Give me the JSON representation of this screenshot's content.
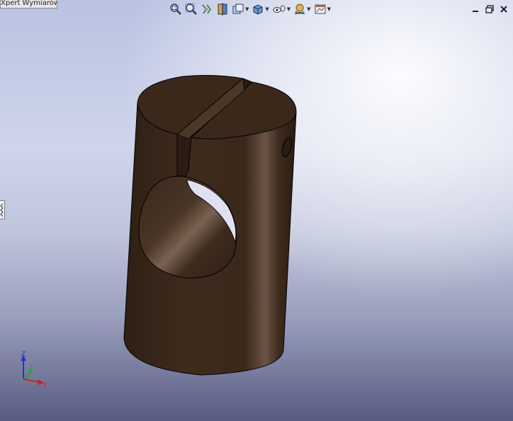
{
  "dimension_expert_tab": {
    "label": "Xpert Wymiarów"
  },
  "toolbar": {
    "items": [
      {
        "name": "zoom-to-fit",
        "icon": "zoom-fit-icon",
        "dropdown": false
      },
      {
        "name": "zoom-to-area",
        "icon": "zoom-area-icon",
        "dropdown": false
      },
      {
        "name": "previous-view",
        "icon": "previous-view-icon",
        "dropdown": false
      },
      {
        "name": "section-view",
        "icon": "section-view-icon",
        "dropdown": false
      },
      {
        "name": "view-orientation",
        "icon": "view-orientation-icon",
        "dropdown": true
      },
      {
        "name": "display-style",
        "icon": "display-style-icon",
        "dropdown": true
      },
      {
        "name": "hide-show-items",
        "icon": "hide-show-icon",
        "dropdown": true
      },
      {
        "name": "edit-appearance",
        "icon": "appearance-icon",
        "dropdown": true
      },
      {
        "name": "apply-scene",
        "icon": "scene-icon",
        "dropdown": true
      }
    ]
  },
  "window_controls": [
    "minimize-icon",
    "restore-icon",
    "close-icon"
  ],
  "triad": {
    "z_label": "Z",
    "y_label": "Y",
    "x_label": "X"
  },
  "colors": {
    "part": "#3d2a1c",
    "part_top": "#3a291b",
    "triad_z": "#2233cc",
    "triad_y": "#22aa22",
    "triad_x": "#cc2222"
  }
}
